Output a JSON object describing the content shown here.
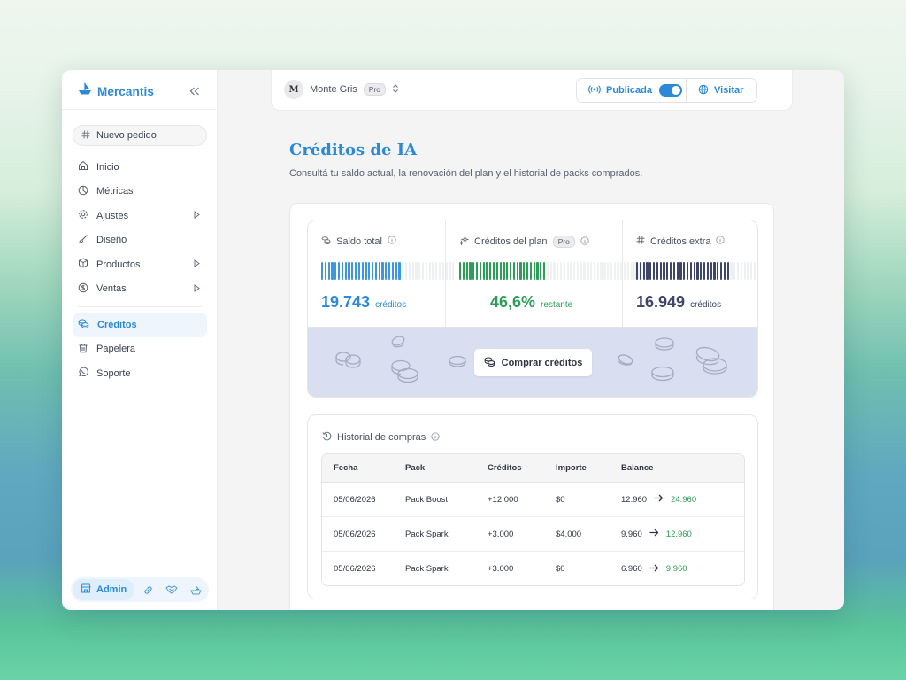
{
  "app": {
    "brand": "Mercantis",
    "new_order": "Nuevo pedido"
  },
  "sidebar": {
    "items": [
      {
        "label": "Inicio",
        "icon": "home-icon"
      },
      {
        "label": "Métricas",
        "icon": "chart-pie-icon"
      },
      {
        "label": "Ajustes",
        "icon": "gear-icon",
        "expandable": true
      },
      {
        "label": "Diseño",
        "icon": "brush-icon"
      },
      {
        "label": "Productos",
        "icon": "box-icon",
        "expandable": true
      },
      {
        "label": "Ventas",
        "icon": "dollar-circle-icon",
        "expandable": true
      }
    ],
    "items2": [
      {
        "label": "Créditos",
        "icon": "coins-icon",
        "active": true
      },
      {
        "label": "Papelera",
        "icon": "trash-icon"
      },
      {
        "label": "Soporte",
        "icon": "whatsapp-icon"
      }
    ],
    "admin_label": "Admin"
  },
  "topbar": {
    "store_initial": "M",
    "store_name": "Monte Gris",
    "store_plan": "Pro",
    "published_label": "Publicada",
    "published_on": true,
    "visit_label": "Visitar"
  },
  "page": {
    "title": "Créditos de IA",
    "subtitle": "Consultá tu saldo actual, la renovación del plan y el historial de packs comprados."
  },
  "stats": {
    "total": {
      "label": "Saldo total",
      "value": "19.743",
      "unit": "créditos",
      "fill": 0.6
    },
    "plan": {
      "label": "Créditos del plan",
      "badge": "Pro",
      "value": "46,6%",
      "unit": "restante",
      "fill": 0.466
    },
    "extra": {
      "label": "Créditos extra",
      "value": "16.949",
      "unit": "créditos",
      "fill": 0.7
    },
    "buy_label": "Comprar créditos"
  },
  "history": {
    "title": "Historial de compras",
    "columns": [
      "Fecha",
      "Pack",
      "Créditos",
      "Importe",
      "Balance"
    ],
    "rows": [
      {
        "fecha": "05/06/2026",
        "pack": "Pack Boost",
        "creditos": "+12.000",
        "importe": "$0",
        "from": "12.960",
        "to": "24.960"
      },
      {
        "fecha": "05/06/2026",
        "pack": "Pack Spark",
        "creditos": "+3.000",
        "importe": "$4.000",
        "from": "9.960",
        "to": "12.960"
      },
      {
        "fecha": "05/06/2026",
        "pack": "Pack Spark",
        "creditos": "+3.000",
        "importe": "$0",
        "from": "6.960",
        "to": "9.960"
      }
    ]
  },
  "colors": {
    "accent": "#2b89d6",
    "plan_green": "#2e9d57",
    "extra_navy": "#3d4568",
    "buy_bg": "#d9dff0"
  }
}
